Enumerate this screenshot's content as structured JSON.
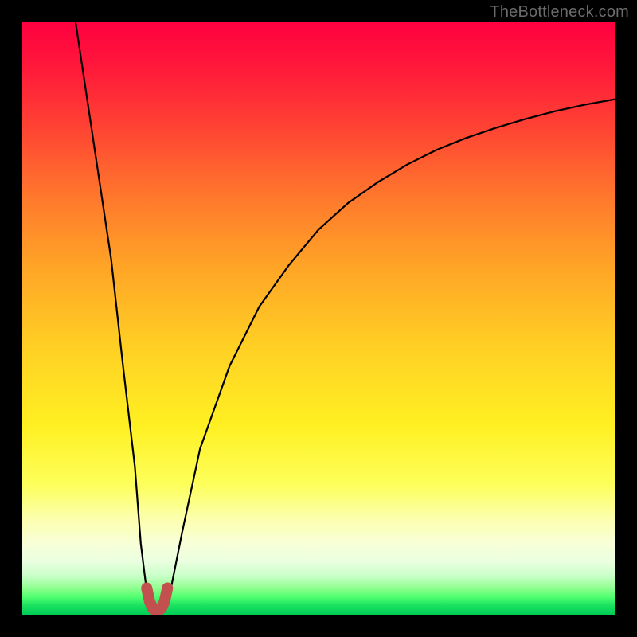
{
  "watermark": "TheBottleneck.com",
  "chart_data": {
    "type": "line",
    "title": "",
    "xlabel": "",
    "ylabel": "",
    "xlim": [
      0,
      100
    ],
    "ylim": [
      0,
      100
    ],
    "grid": false,
    "legend": false,
    "series": [
      {
        "name": "bottleneck-curve",
        "x": [
          9,
          12,
          15,
          17,
          19,
          20,
          21,
          22,
          23,
          24,
          25,
          27,
          30,
          35,
          40,
          45,
          50,
          55,
          60,
          65,
          70,
          75,
          80,
          85,
          90,
          95,
          100
        ],
        "y": [
          100,
          80,
          60,
          42,
          25,
          12,
          4,
          1,
          0,
          1,
          4,
          14,
          28,
          42,
          52,
          59,
          65,
          69.5,
          73,
          76,
          78.5,
          80.5,
          82.2,
          83.7,
          85,
          86.1,
          87
        ]
      },
      {
        "name": "min-marker",
        "x": [
          21,
          21.5,
          22,
          22.5,
          23,
          23.5,
          24,
          24.5
        ],
        "y": [
          4.5,
          2.2,
          1.1,
          0.7,
          0.7,
          1.1,
          2.2,
          4.5
        ]
      }
    ],
    "colors": {
      "curve": "#000000",
      "marker": "#c1504f"
    }
  }
}
